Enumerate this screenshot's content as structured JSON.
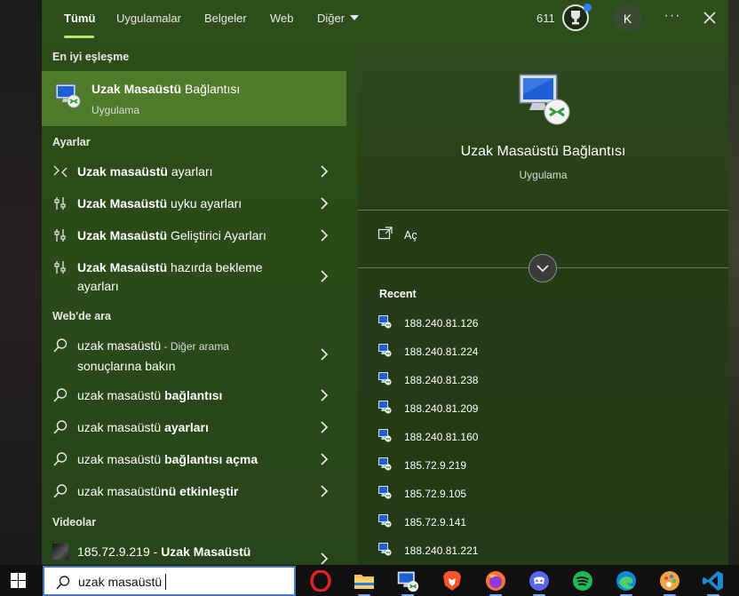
{
  "header": {
    "tabs": [
      {
        "label": "Tümü",
        "active": true
      },
      {
        "label": "Uygulamalar"
      },
      {
        "label": "Belgeler"
      },
      {
        "label": "Web"
      },
      {
        "label": "Diğer"
      }
    ],
    "points": "611",
    "avatar_initial": "K",
    "more_glyph": "···"
  },
  "best_match": {
    "section": "En iyi eşleşme",
    "title_bold": "Uzak Masaüstü",
    "title_rest": " Bağlantısı",
    "subtitle": "Uygulama"
  },
  "settings": {
    "section": "Ayarlar",
    "items": [
      {
        "bold": "Uzak masaüstü",
        "rest": " ayarları"
      },
      {
        "bold": "Uzak Masaüstü",
        "rest": " uyku ayarları"
      },
      {
        "bold": "Uzak Masaüstü",
        "rest": " Geliştirici Ayarları"
      },
      {
        "bold": "Uzak Masaüstü",
        "rest": " hazırda bekleme",
        "line2": "ayarları"
      }
    ]
  },
  "web": {
    "section": "Web'de ara",
    "first": {
      "text": "uzak masaüstü",
      "suffix": " - Diğer arama",
      "line2": "sonuçlarına bakın"
    },
    "items": [
      {
        "plain": "uzak masaüstü ",
        "bold": "bağlantısı"
      },
      {
        "plain": "uzak masaüstü ",
        "bold": "ayarları"
      },
      {
        "plain": "uzak masaüstü ",
        "bold": "bağlantısı açma"
      },
      {
        "plain": "uzak masaüstü",
        "bold": "nü etkinleştir"
      }
    ]
  },
  "videos": {
    "section": "Videolar",
    "item": {
      "plain": "185.72.9.219 - ",
      "bold": "Uzak Masaüstü"
    }
  },
  "detail": {
    "title": "Uzak Masaüstü Bağlantısı",
    "subtitle": "Uygulama",
    "open_label": "Aç",
    "recent_header": "Recent",
    "recent": [
      "188.240.81.126",
      "188.240.81.224",
      "188.240.81.238",
      "188.240.81.209",
      "188.240.81.160",
      "185.72.9.219",
      "185.72.9.105",
      "185.72.9.141",
      "188.240.81.221"
    ]
  },
  "taskbar": {
    "search_value": "uzak masaüstü",
    "apps": [
      {
        "name": "opera-icon"
      },
      {
        "name": "file-explorer-icon"
      },
      {
        "name": "remote-desktop-icon"
      },
      {
        "name": "brave-icon"
      },
      {
        "name": "firefox-icon"
      },
      {
        "name": "discord-icon"
      },
      {
        "name": "spotify-icon"
      },
      {
        "name": "edge-icon"
      },
      {
        "name": "paint-icon"
      },
      {
        "name": "vscode-icon"
      }
    ]
  },
  "colors": {
    "accent": "#aee86d",
    "selected_row": "#4f7a2a",
    "flyout_bg": "#2a4b18",
    "taskbar_bg": "#101010"
  }
}
